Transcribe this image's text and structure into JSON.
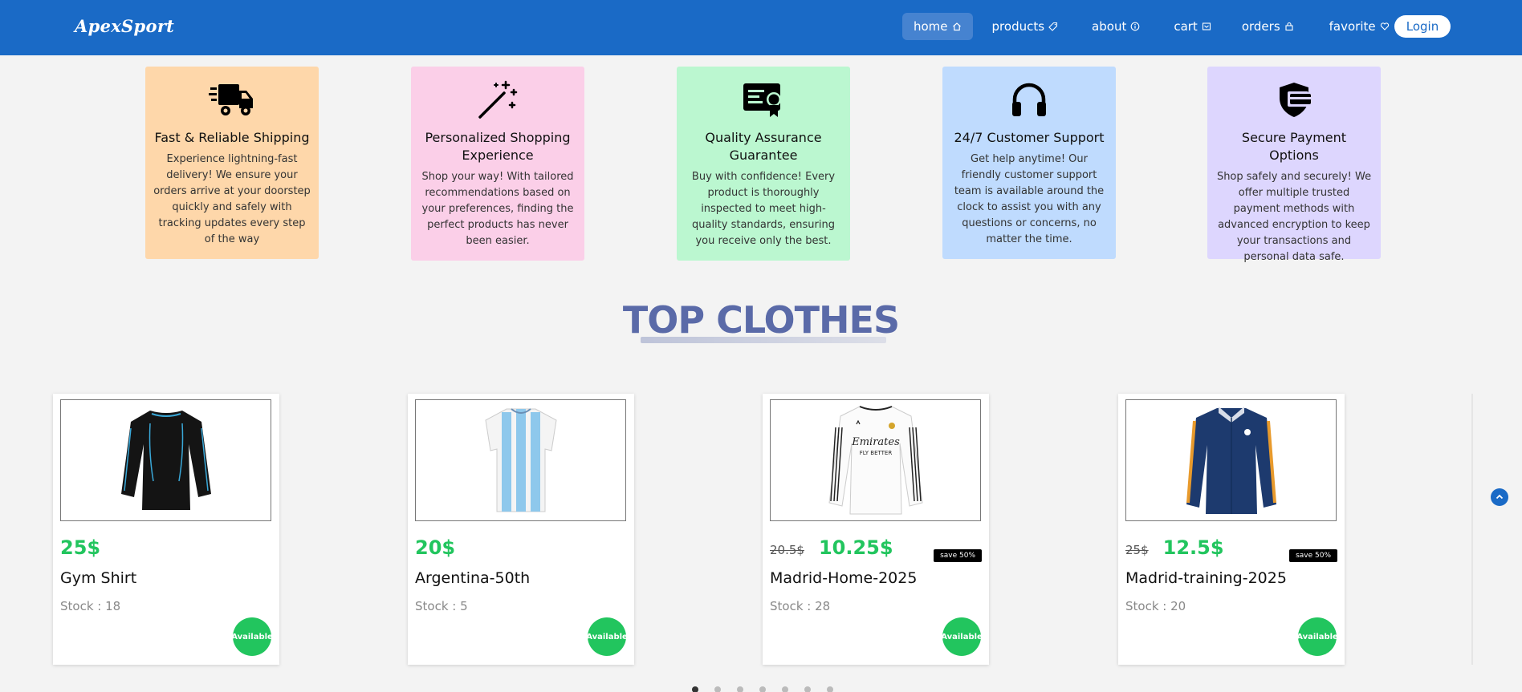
{
  "nav": {
    "logo": "ApexSport",
    "items": [
      {
        "label": "home",
        "icon": "home-icon"
      },
      {
        "label": "products",
        "icon": "tag-icon"
      },
      {
        "label": "about",
        "icon": "info-icon"
      },
      {
        "label": "cart",
        "icon": "cart-icon"
      },
      {
        "label": "orders",
        "icon": "bag-icon"
      },
      {
        "label": "favorite",
        "icon": "heart-icon"
      }
    ],
    "login_label": "Login"
  },
  "features": [
    {
      "title": "Fast & Reliable Shipping",
      "text": "Experience lightning-fast delivery! We ensure your orders arrive at your doorstep quickly and safely with tracking updates every step of the way",
      "icon": "truck-icon",
      "color": "#fed7aa"
    },
    {
      "title": "Personalized Shopping Experience",
      "text": "Shop your way! With tailored recommendations based on your preferences, finding the perfect products has never been easier.",
      "icon": "magic-wand-icon",
      "color": "#fbcfe8"
    },
    {
      "title": "Quality Assurance Guarantee",
      "text": "Buy with confidence! Every product is thoroughly inspected to meet high-quality standards, ensuring you receive only the best.",
      "icon": "certificate-icon",
      "color": "#bbf7d0"
    },
    {
      "title": "24/7 Customer Support",
      "text": "Get help anytime! Our friendly customer support team is available around the clock to assist you with any questions or concerns, no matter the time.",
      "icon": "headphones-icon",
      "color": "#bfdbfe"
    },
    {
      "title": "Secure Payment Options",
      "text": "Shop safely and securely! We offer multiple trusted payment methods with advanced encryption to keep your transactions and personal data safe.",
      "icon": "secure-payment-icon",
      "color": "#ddd6fe"
    }
  ],
  "section_title": "TOP CLOTHES",
  "products": [
    {
      "name": "Gym Shirt",
      "price": "25$",
      "old_price": "",
      "save": "",
      "stock": "Stock : 18",
      "status": "Available"
    },
    {
      "name": "Argentina-50th",
      "price": "20$",
      "old_price": "",
      "save": "",
      "stock": "Stock : 5",
      "status": "Available"
    },
    {
      "name": "Madrid-Home-2025",
      "price": "10.25$",
      "old_price": "20.5$",
      "save": "save 50%",
      "stock": "Stock : 28",
      "status": "Available"
    },
    {
      "name": "Madrid-training-2025",
      "price": "12.5$",
      "old_price": "25$",
      "save": "save 50%",
      "stock": "Stock : 20",
      "status": "Available"
    }
  ],
  "carousel": {
    "dot_count": 7,
    "active_index": 0
  },
  "colors": {
    "primary": "#1a6ac6",
    "price_green": "#22c55e",
    "title": "#5a6aa8"
  }
}
